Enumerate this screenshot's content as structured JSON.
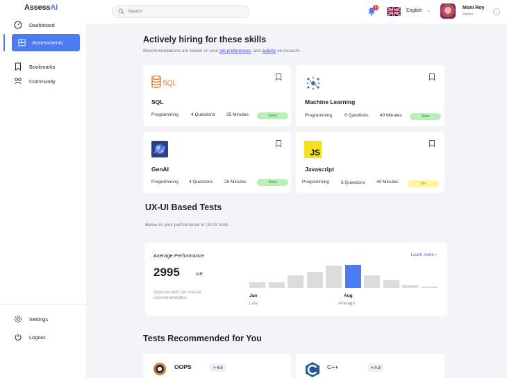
{
  "app": {
    "logo_main": "Assess",
    "logo_accent": "AI"
  },
  "search": {
    "placeholder": "Search"
  },
  "header": {
    "notification_count": "6",
    "language": "English",
    "user_name": "Moni Roy",
    "user_role": "Admin"
  },
  "sidebar": {
    "items": [
      {
        "label": "Dashboard"
      },
      {
        "label": "Assessments"
      },
      {
        "label": "Bookmarks"
      },
      {
        "label": "Community"
      }
    ],
    "bottom": [
      {
        "label": "Settings"
      },
      {
        "label": "Logout"
      }
    ]
  },
  "hiring": {
    "title": "Actively hiring for these skills",
    "subtitle_pre": "Recommendations are based on your ",
    "link1": "job preferences",
    "subtitle_mid": ", and ",
    "link2": "activity",
    "subtitle_post": " on AssesAI.",
    "cards": [
      {
        "title": "SQL",
        "category": "Programming",
        "questions": "4 Questions",
        "duration": "25 Minutes",
        "status": "Done",
        "logo_text": "SQL"
      },
      {
        "title": "Machine Learning",
        "category": "Programming",
        "questions": "6 Questions",
        "duration": "40 Minutes",
        "status": "Done"
      },
      {
        "title": "GenAI",
        "category": "Programming",
        "questions": "4 Questions",
        "duration": "25 Minutes",
        "status": "Done"
      },
      {
        "title": "Javascript",
        "category": "Programming",
        "questions": "6 Questions",
        "duration": "40 Minutes",
        "status": "On",
        "logo_text": "JS"
      }
    ]
  },
  "uxui": {
    "title": "UX-UI Based Tests",
    "subtitle": "Below iis your performance in UI/UX tests"
  },
  "performance": {
    "label": "Average Performance",
    "learn_more": "Learn more ›",
    "score": "2995",
    "score_unit": "AIR",
    "note": "Improve with our course recommendatins",
    "low_month": "Jan",
    "low_label": "Low",
    "avg_month": "Aug",
    "avg_label": "Average",
    "bars": [
      0.26,
      0.26,
      0.56,
      0.71,
      1.0,
      1.03,
      0.56,
      0.33,
      0.13,
      0.07
    ],
    "highlight_index": 5,
    "colors": {
      "bar": "#dcdcdc",
      "highlight": "#4a7bf0"
    }
  },
  "recommended": {
    "title": "Tests Recommended for You",
    "cards": [
      {
        "title": "OOPS",
        "rating": "4.8"
      },
      {
        "title": "C++",
        "rating": "4.8"
      }
    ]
  },
  "colors": {
    "accent": "#4a7bf0",
    "done": "#b9efb9",
    "on": "#fff59a"
  }
}
